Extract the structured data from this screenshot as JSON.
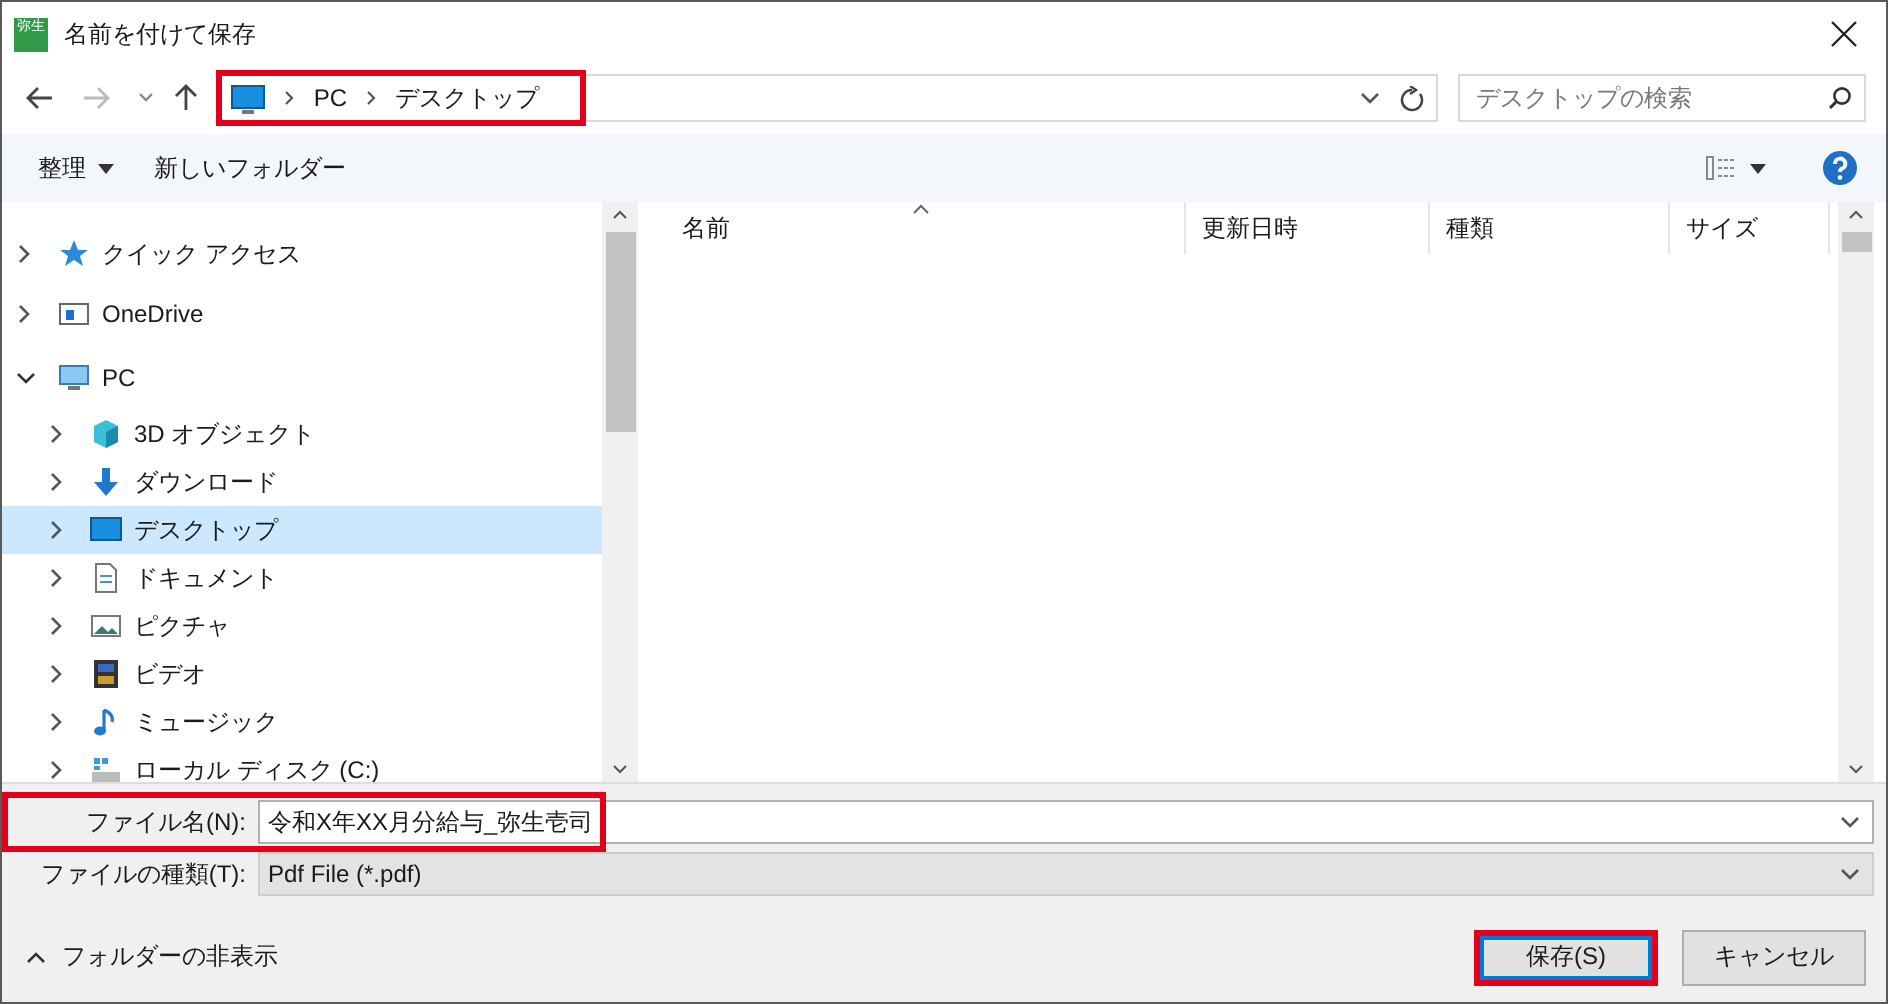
{
  "window": {
    "title": "名前を付けて保存",
    "app_icon": "弥生"
  },
  "address_bar": {
    "path": [
      "PC",
      "デスクトップ"
    ],
    "highlighted": true
  },
  "search": {
    "placeholder": "デスクトップの検索"
  },
  "toolbar": {
    "organize": "整理",
    "new_folder": "新しいフォルダー"
  },
  "tree": [
    {
      "label": "クイック アクセス",
      "expanded": false,
      "selected": false
    },
    {
      "label": "OneDrive",
      "expanded": false,
      "selected": false
    },
    {
      "label": "PC",
      "expanded": true,
      "selected": false,
      "children": [
        {
          "label": "3D オブジェクト",
          "expanded": false,
          "selected": false
        },
        {
          "label": "ダウンロード",
          "expanded": false,
          "selected": false
        },
        {
          "label": "デスクトップ",
          "expanded": false,
          "selected": true
        },
        {
          "label": "ドキュメント",
          "expanded": false,
          "selected": false
        },
        {
          "label": "ピクチャ",
          "expanded": false,
          "selected": false
        },
        {
          "label": "ビデオ",
          "expanded": false,
          "selected": false
        },
        {
          "label": "ミュージック",
          "expanded": false,
          "selected": false
        },
        {
          "label": "ローカル ディスク (C:)",
          "expanded": false,
          "selected": false
        }
      ]
    }
  ],
  "table": {
    "columns": [
      {
        "label": "名前",
        "sorted": true
      },
      {
        "label": "更新日時",
        "sorted": false
      },
      {
        "label": "種類",
        "sorted": false
      },
      {
        "label": "サイズ",
        "sorted": false
      }
    ]
  },
  "file_name": {
    "label": "ファイル名(N):",
    "value": "令和X年XX月分給与_弥生壱司",
    "highlighted": true
  },
  "file_type": {
    "label": "ファイルの種類(T):",
    "value": "Pdf File (*.pdf)"
  },
  "hide_folders": "フォルダーの非表示",
  "buttons": [
    {
      "label": "保存(S)",
      "default": true,
      "highlighted": true
    },
    {
      "label": "キャンセル",
      "default": false,
      "highlighted": false
    }
  ]
}
